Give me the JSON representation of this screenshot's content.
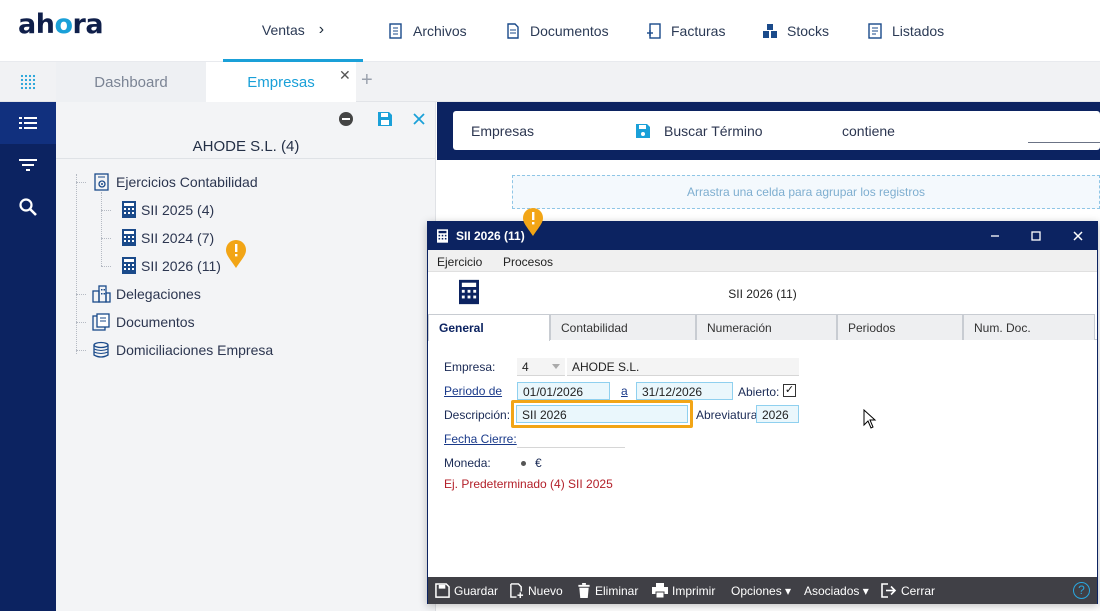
{
  "app": {
    "logo_text_a": "ah",
    "logo_text_o": "o",
    "logo_text_b": "ra"
  },
  "topnav": {
    "ventas": "Ventas",
    "items": [
      {
        "label": "Archivos",
        "icon": "archive-icon"
      },
      {
        "label": "Documentos",
        "icon": "document-icon"
      },
      {
        "label": "Facturas",
        "icon": "invoice-icon"
      },
      {
        "label": "Stocks",
        "icon": "stocks-icon"
      },
      {
        "label": "Listados",
        "icon": "list-report-icon"
      }
    ]
  },
  "tabs": {
    "dashboard": "Dashboard",
    "empresas": "Empresas",
    "close": "✕",
    "add": "+"
  },
  "tree": {
    "title": "AHODE S.L. (4)",
    "nodes": {
      "ejercicios": "Ejercicios Contabilidad",
      "sii2025": "SII 2025 (4)",
      "sii2024": "SII 2024 (7)",
      "sii2026": "SII 2026 (11)",
      "delegaciones": "Delegaciones",
      "documentos": "Documentos",
      "domiciliaciones": "Domiciliaciones Empresa"
    }
  },
  "searchbar": {
    "field": "Empresas",
    "buscar": "Buscar Término",
    "operator": "contiene"
  },
  "grid": {
    "group_hint": "Arrastra una celda para agrupar los registros"
  },
  "dialog": {
    "title": "SII 2026 (11)",
    "menu": {
      "ejercicio": "Ejercicio",
      "procesos": "Procesos"
    },
    "header_title": "SII 2026 (11)",
    "tabs": {
      "general": "General",
      "contabilidad": "Contabilidad",
      "numeracion": "Numeración",
      "periodos": "Periodos",
      "numdoc": "Num. Doc."
    },
    "form": {
      "empresa_label": "Empresa:",
      "empresa_code": "4",
      "empresa_name": "AHODE S.L.",
      "periodo_label": "Periodo de",
      "periodo_from": "01/01/2026",
      "a_label": "a",
      "periodo_to": "31/12/2026",
      "abierto_label": "Abierto:",
      "abierto_check": "✓",
      "descripcion_label": "Descripción:",
      "descripcion": "SII 2026",
      "abreviatura_label": "Abreviatura",
      "abreviatura": "2026",
      "fecha_cierre_label": "Fecha Cierre:",
      "moneda_label": "Moneda:",
      "moneda": "€",
      "predeterminado": "Ej. Predeterminado (4) SII 2025"
    },
    "footer": {
      "guardar": "Guardar",
      "nuevo": "Nuevo",
      "eliminar": "Eliminar",
      "imprimir": "Imprimir",
      "opciones": "Opciones ▾",
      "asociados": "Asociados ▾",
      "cerrar": "Cerrar",
      "help": "?"
    }
  },
  "colors": {
    "navy": "#0c2361",
    "accent": "#1aa0d8",
    "marker": "#f2a516",
    "highlight": "#f2a516",
    "red_text": "#b3202a"
  }
}
